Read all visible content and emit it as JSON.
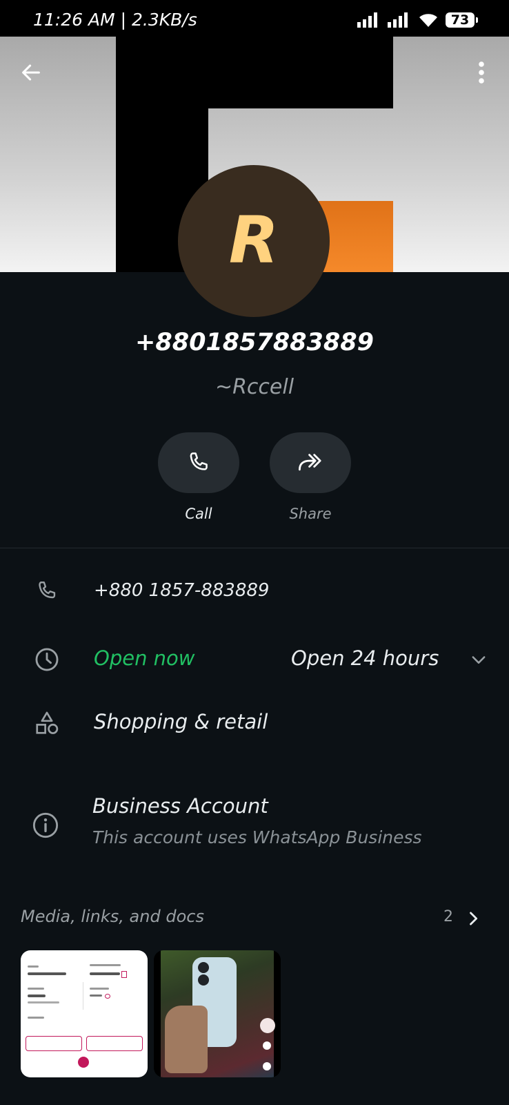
{
  "status_bar": {
    "time": "11:26 AM",
    "speed": "2.3KB/s",
    "battery": "73"
  },
  "header": {
    "avatar_letter": "R",
    "phone_title": "+8801857883889",
    "subname": "~Rccell"
  },
  "actions": [
    {
      "label": "Call",
      "icon": "phone-icon"
    },
    {
      "label": "Share",
      "icon": "forward-icon"
    }
  ],
  "info": {
    "phone": "+880 1857-883889",
    "status": "Open now",
    "hours": "Open 24 hours",
    "category": "Shopping & retail",
    "account_title": "Business Account",
    "account_subtitle": "This account uses WhatsApp Business"
  },
  "media": {
    "title": "Media, links, and docs",
    "count": "2"
  },
  "colors": {
    "background": "#0c1115",
    "accent_green": "#21c063",
    "avatar_bg": "#392c1f",
    "avatar_letter": "#ffd27f",
    "muted": "#9aa0a4"
  }
}
